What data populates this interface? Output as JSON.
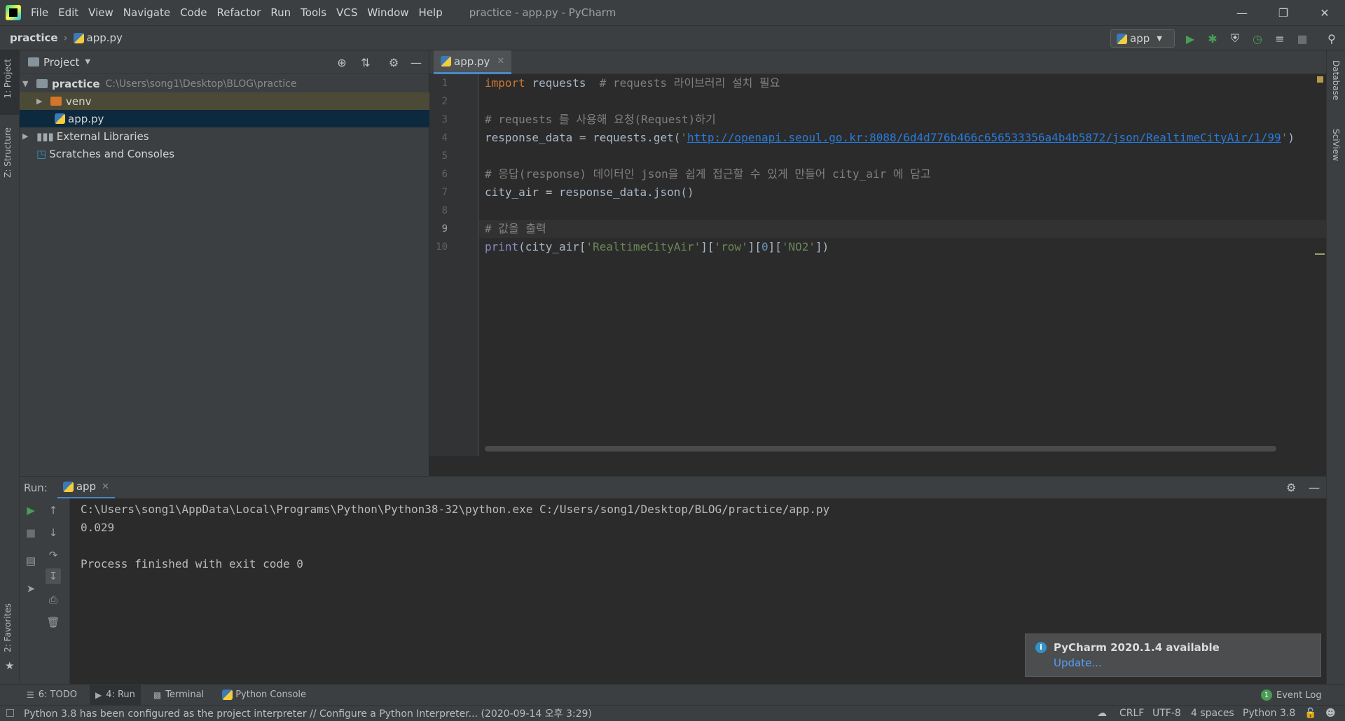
{
  "menu": [
    "File",
    "Edit",
    "View",
    "Navigate",
    "Code",
    "Refactor",
    "Run",
    "Tools",
    "VCS",
    "Window",
    "Help"
  ],
  "window_title": "practice - app.py - PyCharm",
  "breadcrumb": {
    "root": "practice",
    "file": "app.py"
  },
  "run_config": "app",
  "left_stripe": {
    "project": "1: Project",
    "structure": "Z: Structure",
    "favorites": "2: Favorites"
  },
  "right_stripe": {
    "database": "Database",
    "sciview": "SciView"
  },
  "project_panel": {
    "title": "Project",
    "tree": [
      {
        "name": "practice",
        "path": "C:\\Users\\song1\\Desktop\\BLOG\\practice"
      },
      {
        "name": "venv"
      },
      {
        "name": "app.py"
      },
      {
        "name": "External Libraries"
      },
      {
        "name": "Scratches and Consoles"
      }
    ]
  },
  "editor": {
    "tab": "app.py",
    "line_numbers": [
      "1",
      "2",
      "3",
      "4",
      "5",
      "6",
      "7",
      "8",
      "9",
      "10"
    ],
    "lines": {
      "l1_kw": "import",
      "l1_rest": " requests  ",
      "l1_cm": "# requests 라이브러리 설치 필요",
      "l3_cm": "# requests 를 사용해 요청(Request)하기",
      "l4_a": "response_data = requests.get(",
      "l4_q1": "'",
      "l4_url": "http://openapi.seoul.go.kr:8088/6d4d776b466c656533356a4b4b5872/json/RealtimeCityAir/1/99",
      "l4_q2": "'",
      "l4_b": ")",
      "l6_cm": "# 응답(response) 데이터인 json을 쉽게 접근할 수 있게 만들어 city_air 에 담고",
      "l7": "city_air = response_data.json()",
      "l9_cm": "# 값을 출력",
      "l10_fn": "print",
      "l10_a": "(city_air[",
      "l10_s1": "'RealtimeCityAir'",
      "l10_b": "][",
      "l10_s2": "'row'",
      "l10_c": "][",
      "l10_n": "0",
      "l10_d": "][",
      "l10_s3": "'NO2'",
      "l10_e": "])"
    }
  },
  "run_panel": {
    "label": "Run:",
    "tab": "app",
    "output": [
      "C:\\Users\\song1\\AppData\\Local\\Programs\\Python\\Python38-32\\python.exe C:/Users/song1/Desktop/BLOG/practice/app.py",
      "0.029",
      "",
      "Process finished with exit code 0"
    ]
  },
  "notification": {
    "title": "PyCharm 2020.1.4 available",
    "link": "Update..."
  },
  "tool_tabs": {
    "todo": "6: TODO",
    "run": "4: Run",
    "terminal": "Terminal",
    "python_console": "Python Console",
    "event_log": "Event Log",
    "event_count": "1"
  },
  "statusbar": {
    "message": "Python 3.8 has been configured as the project interpreter // Configure a Python Interpreter... (2020-09-14 오후 3:29)",
    "line_sep": "CRLF",
    "encoding": "UTF-8",
    "indent": "4 spaces",
    "interpreter": "Python 3.8"
  },
  "colors": {
    "accent": "#4a88c7",
    "keyword": "#cc7832",
    "comment": "#808080",
    "string": "#6a8759",
    "run_green": "#499c54"
  }
}
